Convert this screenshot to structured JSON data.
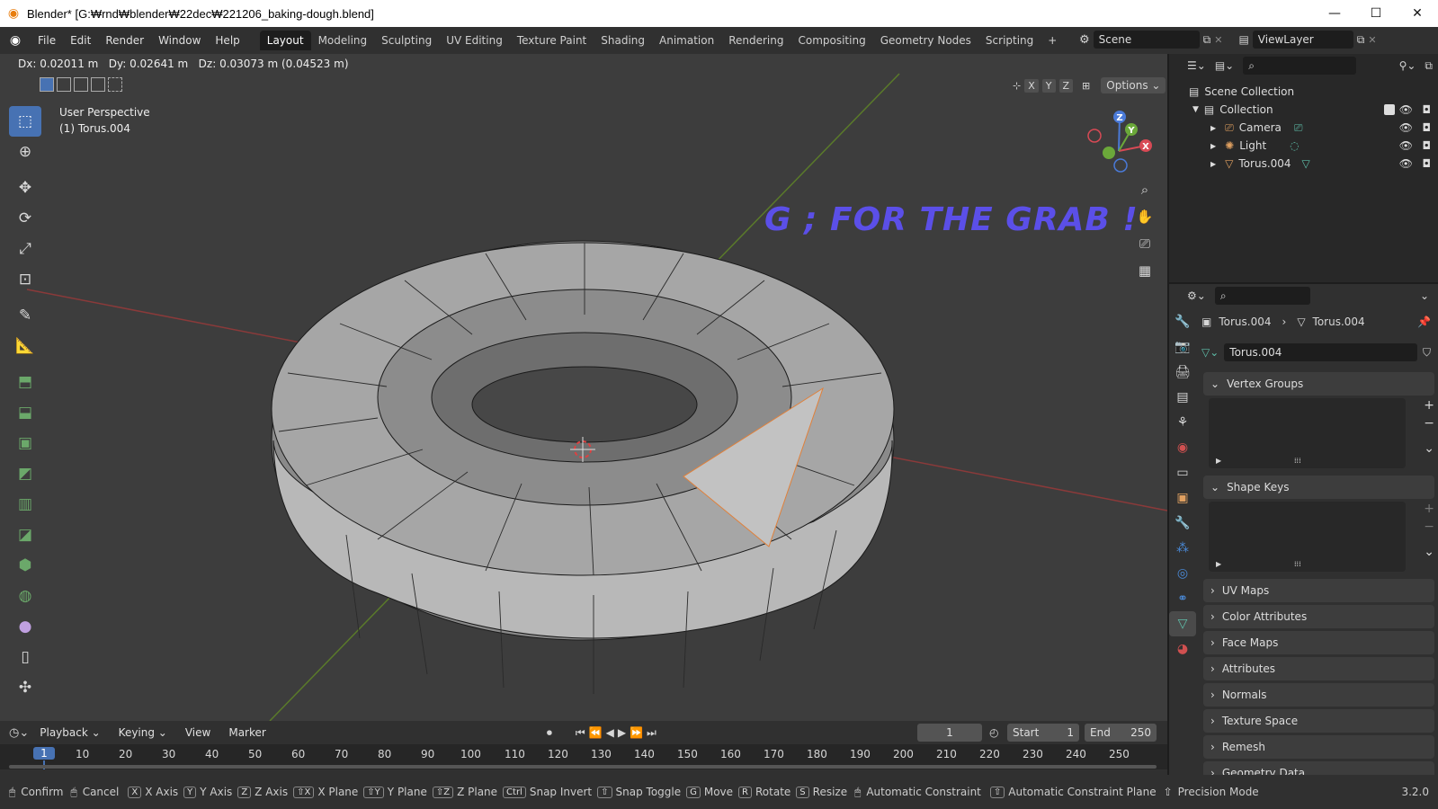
{
  "window": {
    "title": "Blender* [G:₩rnd₩blender₩22dec₩221206_baking-dough.blend]",
    "minimize": "—",
    "maximize": "☐",
    "close": "✕"
  },
  "menu": [
    "File",
    "Edit",
    "Render",
    "Window",
    "Help"
  ],
  "workspaces": [
    "Layout",
    "Modeling",
    "Sculpting",
    "UV Editing",
    "Texture Paint",
    "Shading",
    "Animation",
    "Rendering",
    "Compositing",
    "Geometry Nodes",
    "Scripting"
  ],
  "add_workspace": "+",
  "scene": "Scene",
  "view_layer": "ViewLayer",
  "viewport": {
    "transform_info": "Dx: 0.02011 m   Dy: 0.02641 m   Dz: 0.03073 m (0.04523 m)",
    "perspective_label": "User Perspective",
    "object_label": "(1) Torus.004",
    "axis_x": "X",
    "axis_y": "Y",
    "axis_z": "Z",
    "options_label": "Options",
    "annotation": "G ; FOR THE GRAB !",
    "annotation_color": "#5b4fe8",
    "gizmo_labels": {
      "x": "X",
      "y": "Y",
      "z": "Z"
    }
  },
  "timeline": {
    "menus": [
      "Playback",
      "Keying",
      "View",
      "Marker"
    ],
    "current_frame": "1",
    "start_label": "Start",
    "start_value": "1",
    "end_label": "End",
    "end_value": "250",
    "ruler": [
      "1",
      "10",
      "20",
      "30",
      "40",
      "50",
      "60",
      "70",
      "80",
      "90",
      "100",
      "110",
      "120",
      "130",
      "140",
      "150",
      "160",
      "170",
      "180",
      "190",
      "200",
      "210",
      "220",
      "230",
      "240",
      "250"
    ]
  },
  "outliner": {
    "scene_collection": "Scene Collection",
    "collection": "Collection",
    "items": [
      "Camera",
      "Light",
      "Torus.004"
    ]
  },
  "properties": {
    "breadcrumb_object": "Torus.004",
    "breadcrumb_mesh": "Torus.004",
    "mesh_name": "Torus.004",
    "panels_open": [
      "Vertex Groups",
      "Shape Keys"
    ],
    "panels_closed": [
      "UV Maps",
      "Color Attributes",
      "Face Maps",
      "Attributes",
      "Normals",
      "Texture Space",
      "Remesh",
      "Geometry Data"
    ]
  },
  "statusbar": {
    "items": [
      {
        "key": "",
        "label": "Confirm"
      },
      {
        "key": "",
        "label": "Cancel"
      },
      {
        "key": "X",
        "label": "X Axis"
      },
      {
        "key": "Y",
        "label": "Y Axis"
      },
      {
        "key": "Z",
        "label": "Z Axis"
      },
      {
        "key": "⇧X",
        "label": "X Plane"
      },
      {
        "key": "⇧Y",
        "label": "Y Plane"
      },
      {
        "key": "⇧Z",
        "label": "Z Plane"
      },
      {
        "key": "Ctrl",
        "label": "Snap Invert"
      },
      {
        "key": "⇧",
        "label": "Snap Toggle"
      },
      {
        "key": "G",
        "label": "Move"
      },
      {
        "key": "R",
        "label": "Rotate"
      },
      {
        "key": "S",
        "label": "Resize"
      },
      {
        "key": "",
        "label": "Automatic Constraint"
      },
      {
        "key": "⇧",
        "label": "Automatic Constraint Plane"
      },
      {
        "key": "",
        "label": "Precision Mode"
      }
    ],
    "version": "3.2.0"
  }
}
